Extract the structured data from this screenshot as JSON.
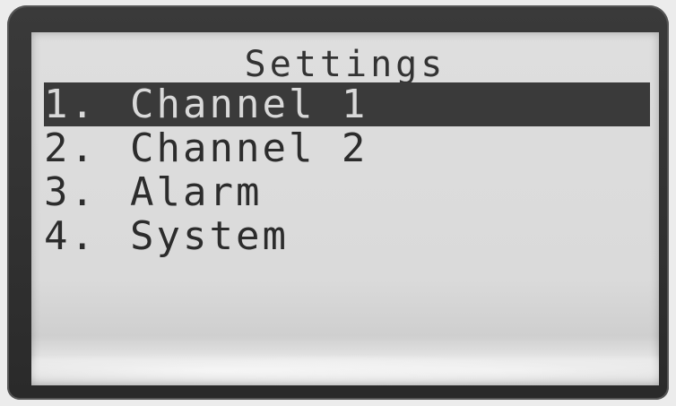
{
  "screen": {
    "title": "Settings",
    "menu": [
      {
        "number": "1.",
        "label": "Channel 1",
        "selected": true
      },
      {
        "number": "2.",
        "label": "Channel 2",
        "selected": false
      },
      {
        "number": "3.",
        "label": "Alarm",
        "selected": false
      },
      {
        "number": "4.",
        "label": "System",
        "selected": false
      }
    ]
  },
  "colors": {
    "lcd_background": "#dadada",
    "pixel_text": "#2c2c2c",
    "highlight_bar": "#3a3a3a",
    "bezel": "#2a2a2a"
  }
}
